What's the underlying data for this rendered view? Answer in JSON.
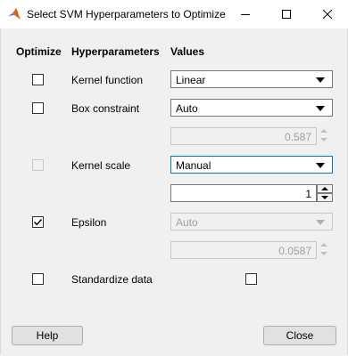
{
  "window": {
    "title": "Select SVM Hyperparameters to Optimize"
  },
  "headers": {
    "optimize": "Optimize",
    "hyperparameters": "Hyperparameters",
    "values": "Values"
  },
  "rows": {
    "kernel_function": {
      "label": "Kernel function",
      "value": "Linear",
      "optimize_checked": false
    },
    "box_constraint": {
      "label": "Box constraint",
      "value": "Auto",
      "spin_value": "0.587",
      "optimize_checked": false
    },
    "kernel_scale": {
      "label": "Kernel scale",
      "value": "Manual",
      "spin_value": "1",
      "optimize_checked": false,
      "optimize_enabled": false
    },
    "epsilon": {
      "label": "Epsilon",
      "value": "Auto",
      "spin_value": "0.0587",
      "optimize_checked": true
    },
    "standardize": {
      "label": "Standardize data",
      "optimize_checked": false,
      "value_checked": false
    }
  },
  "buttons": {
    "help": "Help",
    "close": "Close"
  },
  "icons": {
    "app": "matlab-icon",
    "minimize": "minimize-icon",
    "maximize": "maximize-icon",
    "close": "close-icon"
  },
  "colors": {
    "focus_border": "#0078d7",
    "window_bg": "#f0f0f0"
  }
}
